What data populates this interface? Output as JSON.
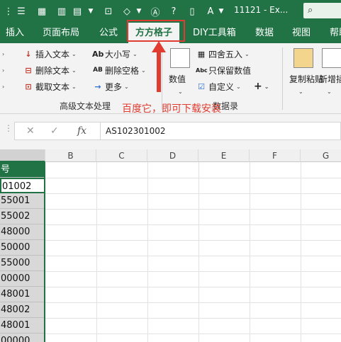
{
  "title_bar": {
    "title": "11121 - Ex...",
    "search_icon": "search-icon"
  },
  "tabs": [
    {
      "label": "插入"
    },
    {
      "label": "页面布局"
    },
    {
      "label": "公式"
    },
    {
      "label": "方方格子"
    },
    {
      "label": "DIY工具箱"
    },
    {
      "label": "数据"
    },
    {
      "label": "视图"
    },
    {
      "label": "帮助"
    }
  ],
  "ribbon": {
    "insert_text": "插入文本",
    "delete_text": "删除文本",
    "extract_text": "截取文本",
    "case": "大小写",
    "remove_spaces": "删除空格",
    "more": "更多",
    "group_label": "高级文本处理",
    "numeric": "数值",
    "round": "四舍五入",
    "keep_values": "只保留数值",
    "custom": "自定义",
    "plus": "+",
    "copy_paste": "复制粘贴",
    "new_insert": "新增插入",
    "group_label_2": "数据录"
  },
  "annotation": {
    "text": "百度它，即可下载安装",
    "color": "#e03c31"
  },
  "formula_bar": {
    "fx": "fx",
    "value": "AS102301002"
  },
  "grid": {
    "columns": [
      "B",
      "C",
      "D",
      "E",
      "F",
      "G"
    ],
    "column_a_header": "号",
    "column_a_values": [
      "01002",
      "55001",
      "55002",
      "48000",
      "50000",
      "55000",
      "00000",
      "48001",
      "48002",
      "48001",
      "00000"
    ]
  },
  "colors": {
    "accent": "#217346",
    "highlight": "#e03c31"
  }
}
